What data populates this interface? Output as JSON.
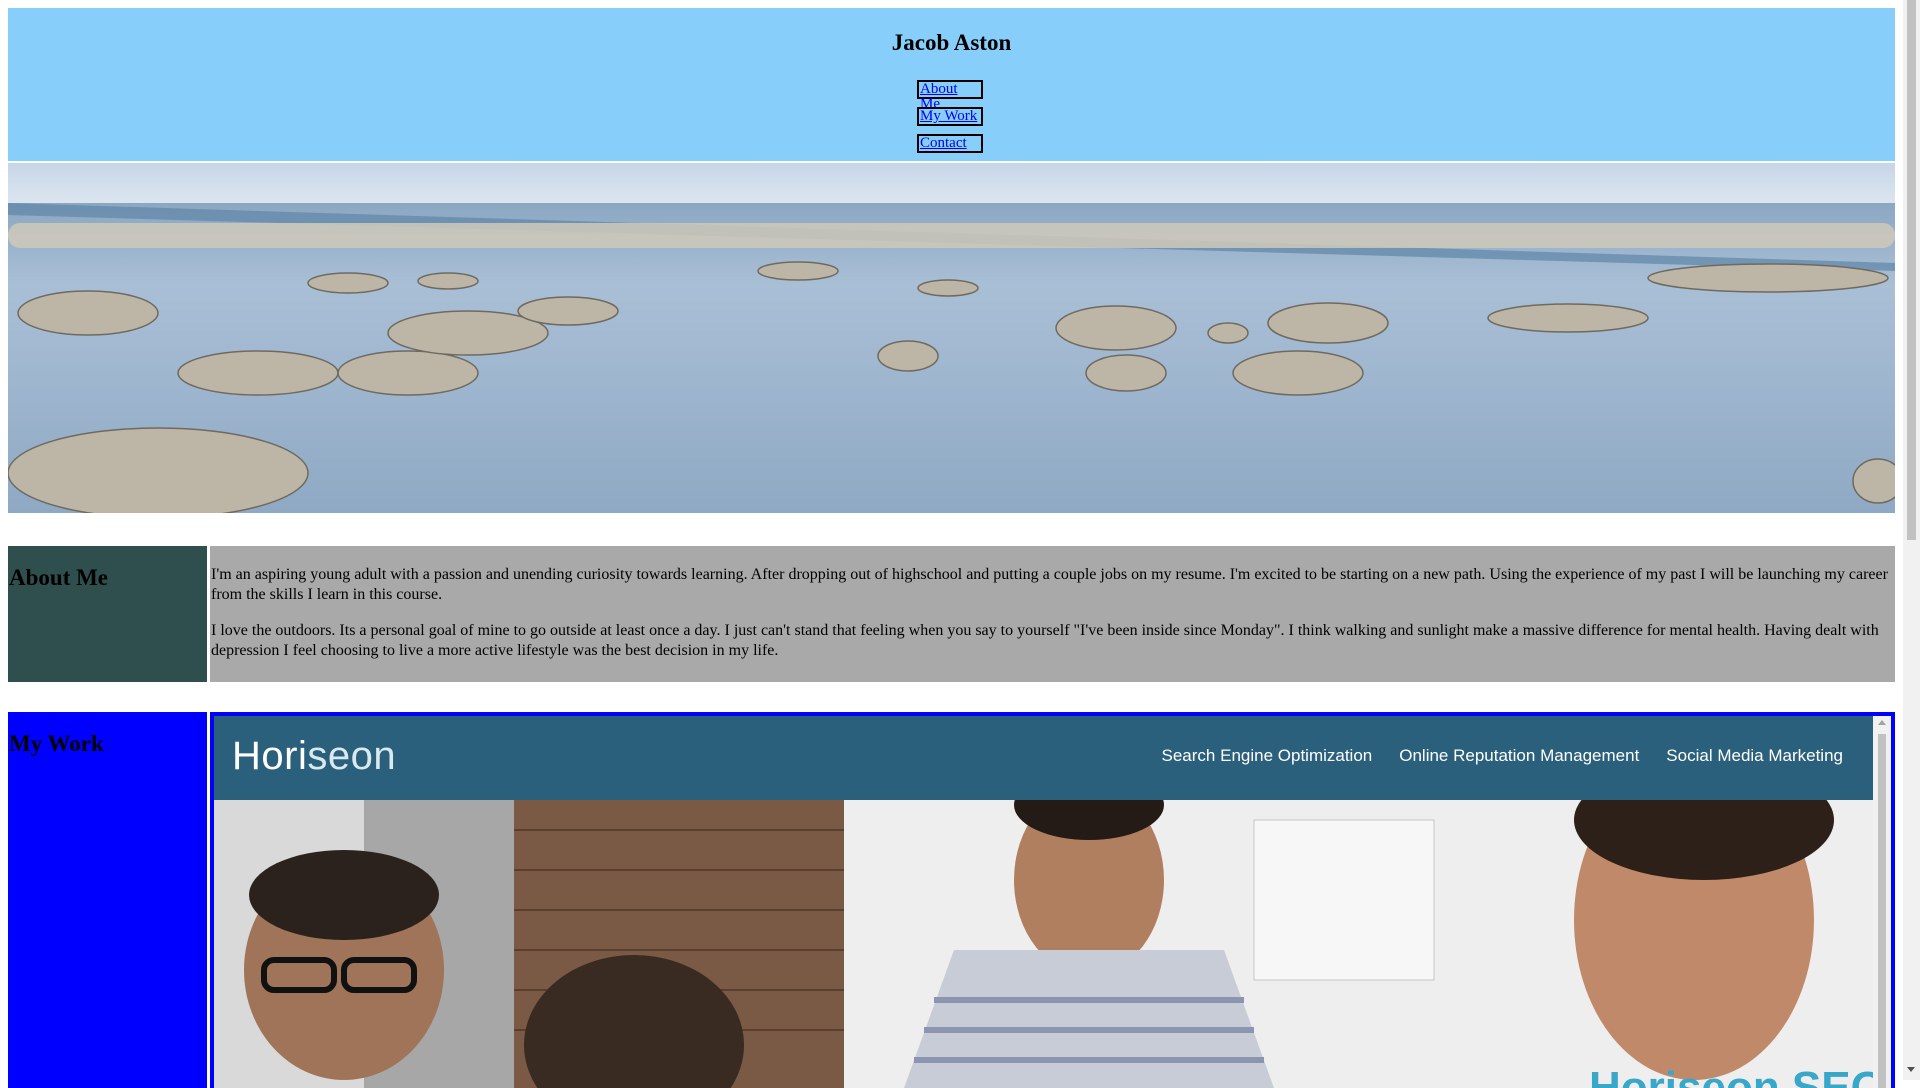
{
  "header": {
    "title": "Jacob Aston",
    "nav": [
      "About Me",
      "My Work",
      "Contact"
    ]
  },
  "about": {
    "heading": "About Me",
    "paragraphs": [
      "I'm an aspiring young adult with a passion and unending curiosity towards learning. After dropping out of highschool and putting a couple jobs on my resume. I'm excited to be starting on a new path. Using the experience of my past I will be launching my career from the skills I learn in this course.",
      "I love the outdoors. Its a personal goal of mine to go outside at least once a day. I just can't stand that feeling when you say to yourself \"I've been inside since Monday\". I think walking and sunlight make a massive difference for mental health. Having dealt with depression I feel choosing to live a more active lifestyle was the best decision in my life."
    ]
  },
  "work": {
    "heading": "My Work",
    "project": {
      "logo_main": "Hori",
      "logo_accent": "seon",
      "nav": [
        "Search Engine Optimization",
        "Online Reputation Management",
        "Social Media Marketing"
      ],
      "overlay_text": "Horiseon SEO"
    }
  },
  "colors": {
    "header_bg": "#87cefa",
    "about_label_bg": "#2f4f4f",
    "about_body_bg": "#a9a9a9",
    "work_bg": "#0000ff",
    "horiseon_header": "#2a607c"
  }
}
